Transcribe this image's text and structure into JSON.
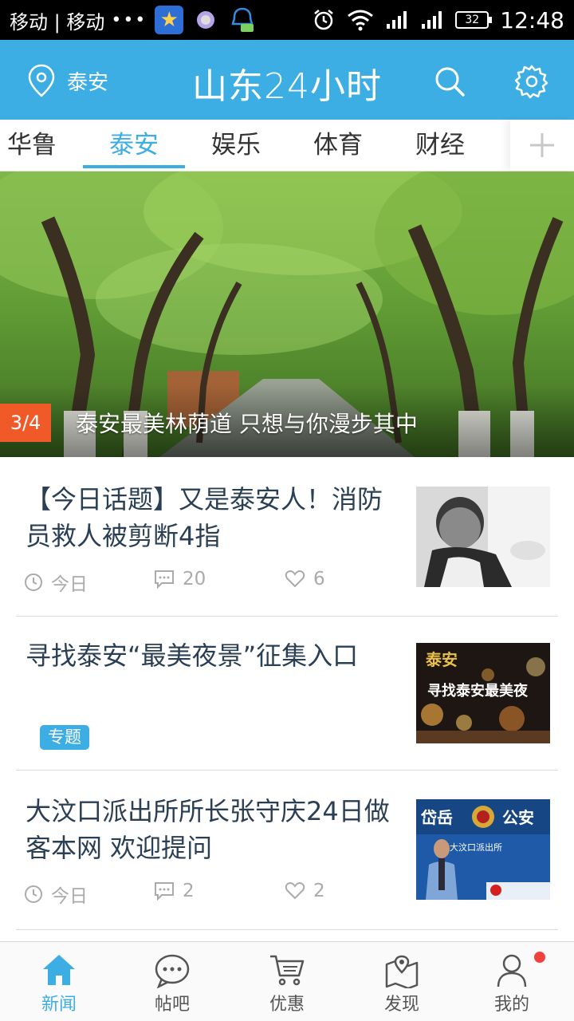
{
  "status_bar": {
    "carrier": "移动 | 移动",
    "dots": "•••",
    "battery": "32",
    "time": "12:48"
  },
  "header": {
    "location": "泰安",
    "title": "山东24小时"
  },
  "tabs": [
    {
      "label": "华鲁",
      "active": false
    },
    {
      "label": "泰安",
      "active": true
    },
    {
      "label": "娱乐",
      "active": false
    },
    {
      "label": "体育",
      "active": false
    },
    {
      "label": "财经",
      "active": false
    }
  ],
  "banner": {
    "counter": "3/4",
    "caption": "泰安最美林荫道 只想与你漫步其中"
  },
  "news": [
    {
      "title": "【今日话题】又是泰安人！消防员救人被剪断4指",
      "time": "今日",
      "comments": "20",
      "likes": "6"
    },
    {
      "title": "寻找泰安“最美夜景”征集入口",
      "tag": "专题",
      "thumb_text_1": "泰安",
      "thumb_text_2": "寻找泰安最美夜"
    },
    {
      "title": "大汶口派出所所长张守庆24日做客本网 欢迎提问",
      "time": "今日",
      "comments": "2",
      "likes": "2",
      "thumb_text_1": "岱岳",
      "thumb_text_2": "公安",
      "thumb_text_3": "大汶口派出所"
    }
  ],
  "bottom_nav": [
    {
      "label": "新闻",
      "icon": "home-icon",
      "active": true
    },
    {
      "label": "帖吧",
      "icon": "chat-bubble-icon",
      "active": false
    },
    {
      "label": "优惠",
      "icon": "cart-icon",
      "active": false
    },
    {
      "label": "发现",
      "icon": "map-icon",
      "active": false
    },
    {
      "label": "我的",
      "icon": "user-icon",
      "active": false
    }
  ],
  "colors": {
    "brand": "#3daee3",
    "counter": "#f05a28",
    "badge": "#f0413a"
  }
}
